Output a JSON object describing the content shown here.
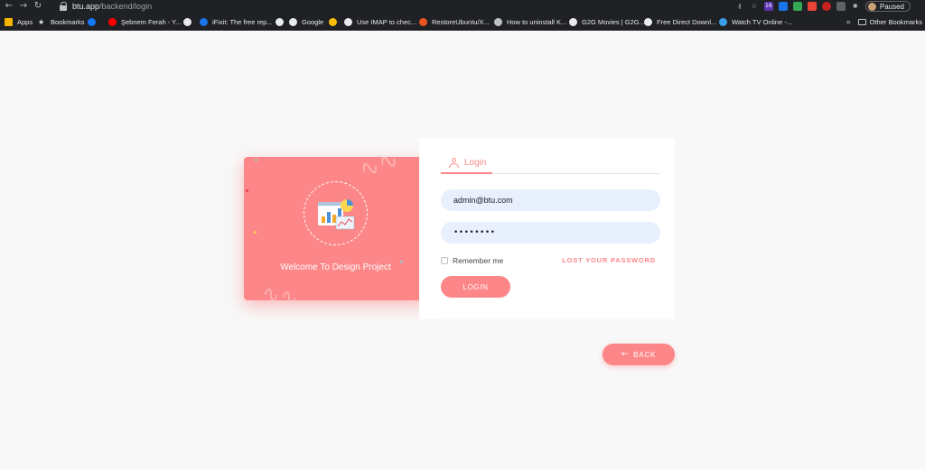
{
  "browser": {
    "url_domain": "btu.app",
    "url_path": "/backend/login",
    "profile_status": "Paused",
    "extension_badge": "16"
  },
  "bookmarks": {
    "items": [
      {
        "label": "Apps",
        "icon": "apps-grid-icon",
        "color": "#f4b400"
      },
      {
        "label": "Bookmarks",
        "icon": "star-icon",
        "color": "#e8eaed"
      },
      {
        "label": "",
        "icon": "facebook-icon",
        "color": "#1877f2"
      },
      {
        "label": "Şebnem Ferah - Y...",
        "icon": "youtube-icon",
        "color": "#ff0000"
      },
      {
        "label": "",
        "icon": "page-icon",
        "color": "#e8eaed"
      },
      {
        "label": "iFixit: The free rep...",
        "icon": "ifixit-icon",
        "color": "#1a73e8"
      },
      {
        "label": "",
        "icon": "globe-icon",
        "color": "#e8eaed"
      },
      {
        "label": "Google",
        "icon": "google-icon",
        "color": "#e8eaed"
      },
      {
        "label": "",
        "icon": "drive-icon",
        "color": "#fbbc04"
      },
      {
        "label": "Use IMAP to chec...",
        "icon": "google-icon",
        "color": "#e8eaed"
      },
      {
        "label": "RestoreUbuntu/X...",
        "icon": "ubuntu-icon",
        "color": "#e95420"
      },
      {
        "label": "How to uninstall K...",
        "icon": "link-icon",
        "color": "#bdc1c6"
      },
      {
        "label": "G2G Movies | G2G...",
        "icon": "globe-icon",
        "color": "#e8eaed"
      },
      {
        "label": "Free Direct Downl...",
        "icon": "globe-icon",
        "color": "#e8eaed"
      },
      {
        "label": "Watch TV Online -...",
        "icon": "tv-icon",
        "color": "#3aa0e8"
      }
    ],
    "overflow": "»",
    "other_label": "Other Bookmarks"
  },
  "welcome": {
    "text": "Welcome To Design Project"
  },
  "login": {
    "tab_label": "Login",
    "email_value": "admin@btu.com",
    "password_value": "••••••••",
    "remember_label": "Remember me",
    "lost_password_label": "LOST YOUR PASSWORD",
    "submit_label": "LOGIN"
  },
  "back": {
    "label": "BACK"
  },
  "colors": {
    "accent": "#fc8688",
    "background": "#f8f8f8",
    "field_fill": "#e8f0fe"
  }
}
